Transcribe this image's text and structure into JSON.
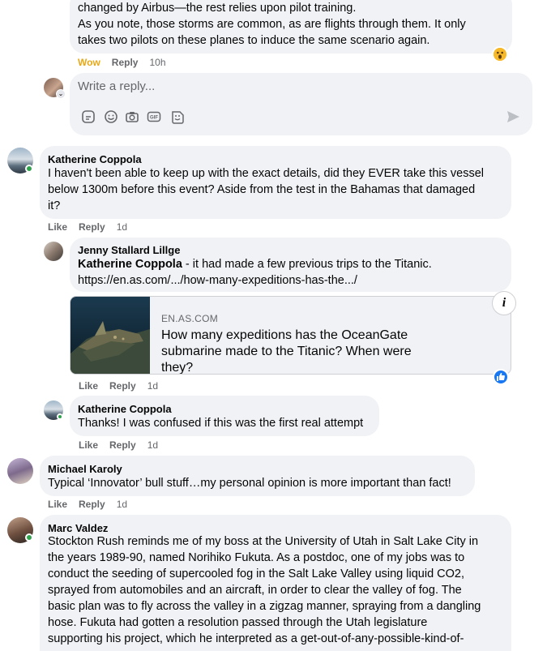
{
  "comment_top": {
    "lines": [
      "changed by Airbus—the rest relies upon pilot training.",
      "As you note, those storms are common, as are flights through them. It only",
      "takes two pilots on these planes to induce the same scenario again."
    ],
    "actions": {
      "reaction": "Wow",
      "reply": "Reply",
      "time": "10h"
    }
  },
  "reply_composer": {
    "placeholder": "Write a reply...",
    "tools": [
      "sticker-icon",
      "emoji-icon",
      "camera-icon",
      "gif-icon",
      "avatar-sticker-icon"
    ],
    "send_icon": "send-icon"
  },
  "comments": [
    {
      "author": "Katherine Coppola",
      "lines": [
        "I haven't been able to keep up with the exact details, did they EVER take this vessel",
        "below 1300m before this event? Aside from the test in the Bahamas that damaged",
        "it?"
      ],
      "actions": {
        "like": "Like",
        "reply": "Reply",
        "time": "1d"
      }
    },
    {
      "author": "Jenny Stallard Lillge",
      "mention": "Katherine Coppola",
      "text_after_mention": " - it had made a few previous trips to the Titanic.",
      "link": "https://en.as.com/.../how-many-expeditions-has-the.../",
      "card": {
        "domain": "EN.AS.COM",
        "title": "How many expeditions has the OceanGate submarine made to the Titanic? When were they?"
      },
      "actions": {
        "like": "Like",
        "reply": "Reply",
        "time": "1d"
      }
    },
    {
      "author": "Katherine Coppola",
      "text": "Thanks! I was confused if this was the first real attempt",
      "actions": {
        "like": "Like",
        "reply": "Reply",
        "time": "1d"
      }
    },
    {
      "author": "Michael Karoly",
      "text": "Typical ‘Innovator’ bull stuff…my personal opinion is more important than fact!",
      "actions": {
        "like": "Like",
        "reply": "Reply",
        "time": "1d"
      }
    },
    {
      "author": "Marc Valdez",
      "lines": [
        "Stockton Rush reminds me of my boss at the University of Utah in Salt Lake City in",
        "the years 1989-90, named Norihiko Fukuta. As a postdoc, one of my jobs was to",
        "conduct the seeding of supercooled fog in the Salt Lake Valley using liquid CO2,",
        "sprayed from automobiles and an aircraft, in order to clear the valley of fog. The",
        "basic plan was to fly across the valley in a zigzag manner, spraying from a dangling",
        "hose. Fukuta had gotten a resolution passed through the Utah legislature",
        "supporting his project, which he interpreted as a get-out-of-any-possible-kind-of-"
      ]
    }
  ],
  "colors": {
    "bubble": "#f0f2f5",
    "link": "#385898",
    "wow": "#e7a816",
    "online": "#31a24c",
    "like_reaction": "#1877f2"
  }
}
